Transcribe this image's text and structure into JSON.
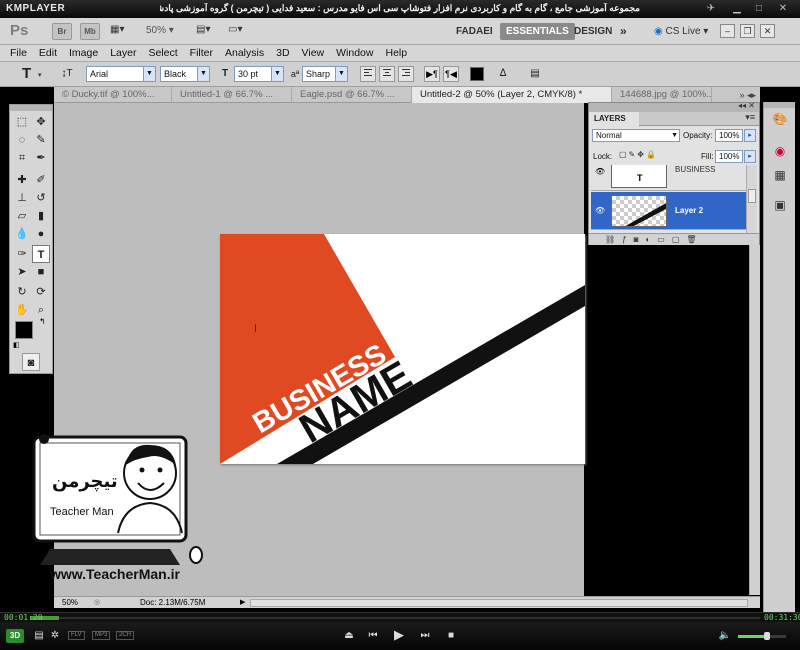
{
  "player": {
    "logo": "KMPLAYER",
    "caption": "مجموعه آموزشی جامع ، گام به گام و کاربردی نرم افزار فتوشاپ سی اس فایو  مدرس : سعید فدایی ( تیچرمن ) گروه آموزشی پادشاه گرافیست ها",
    "time_elapsed": "00:01:20",
    "time_total": "00:31:30",
    "progress": 0.04,
    "volume": 0.6,
    "format_badges": [
      "FLV",
      "MP3",
      "2CH"
    ],
    "icons": [
      "3d-icon",
      "menu-icon",
      "settings-icon",
      "eject-icon",
      "previous-icon",
      "play-icon",
      "next-icon",
      "stop-icon",
      "speaker-icon"
    ]
  },
  "app": {
    "logo": "Ps",
    "bridge_label": "Br",
    "minibridge_label": "Mb",
    "zoom": "50%",
    "workspaces": [
      "FADAEI",
      "ESSENTIALS",
      "DESIGN"
    ],
    "active_workspace": "ESSENTIALS",
    "cs_live": "CS Live"
  },
  "menu": [
    "File",
    "Edit",
    "Image",
    "Layer",
    "Select",
    "Filter",
    "Analysis",
    "3D",
    "View",
    "Window",
    "Help"
  ],
  "options": {
    "font_family": "Arial",
    "font_style": "Black",
    "font_size": "30 pt",
    "antialias": "Sharp",
    "aa_label": "a",
    "text_color": "#000000"
  },
  "tabs": [
    "© Ducky.tif @ 100%...",
    "Untitled-1 @ 66.7% ...",
    "Eagle.psd @ 66.7% ...",
    "Untitled-2 @ 50% (Layer 2, CMYK/8) *",
    "144688.jpg @ 100%..."
  ],
  "active_tab": 3,
  "canvas": {
    "business": "BUSINESS",
    "name": "NAME",
    "orange": "#e04a22",
    "stripe": "#111111"
  },
  "layers": {
    "title": "LAYERS",
    "blend_mode": "Normal",
    "opacity_label": "Opacity:",
    "opacity": "100%",
    "lock_label": "Lock:",
    "fill_label": "Fill:",
    "fill": "100%",
    "items": [
      {
        "name": "BUSINESS"
      },
      {
        "name": "Layer 2"
      }
    ]
  },
  "status": {
    "zoom": "50%",
    "doc": "Doc: 2.13M/6.75M"
  },
  "watermark": {
    "brand": "Teacher Man",
    "url": "www.TeacherMan.ir"
  }
}
